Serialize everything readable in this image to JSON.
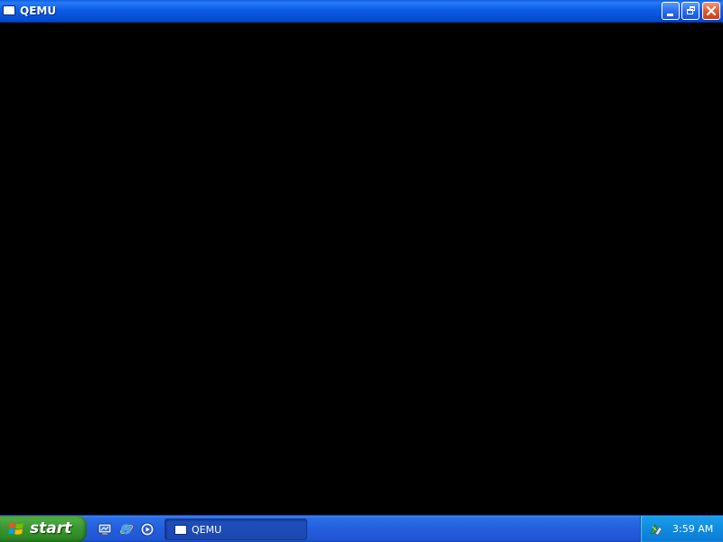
{
  "window": {
    "title": "QEMU",
    "icon": "window-icon",
    "controls": {
      "minimize": "minimize-icon",
      "restore": "restore-icon",
      "close": "close-icon"
    }
  },
  "taskbar": {
    "start_label": "start",
    "quick_launch": [
      {
        "icon": "desktop-icon"
      },
      {
        "icon": "internet-explorer-icon"
      },
      {
        "icon": "media-player-icon"
      }
    ],
    "tasks": [
      {
        "label": "QEMU",
        "icon": "window-icon"
      }
    ],
    "tray": {
      "icons": [
        "network-icon"
      ],
      "clock": "3:59 AM"
    }
  },
  "colors": {
    "titlebar": "#0b5ee3",
    "taskbar": "#245edc",
    "start_button": "#3c9a32",
    "tray": "#0f8be0",
    "close_button": "#e35a2e",
    "client_background": "#000000"
  }
}
